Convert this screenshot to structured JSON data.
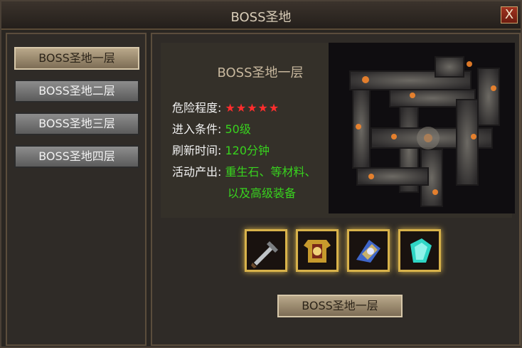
{
  "window": {
    "title": "BOSS圣地",
    "close_label": "X"
  },
  "sidebar": {
    "items": [
      {
        "label": "BOSS圣地一层",
        "active": true
      },
      {
        "label": "BOSS圣地二层",
        "active": false
      },
      {
        "label": "BOSS圣地三层",
        "active": false
      },
      {
        "label": "BOSS圣地四层",
        "active": false
      }
    ]
  },
  "details": {
    "title": "BOSS圣地一层",
    "danger_label": "危险程度:",
    "danger_stars": "★★★★★",
    "danger_rating": 5,
    "entry_label": "进入条件:",
    "entry_value": "50级",
    "refresh_label": "刷新时间:",
    "refresh_value": "120分钟",
    "output_label": "活动产出:",
    "output_value_line1": "重生石、等材料、",
    "output_value_line2": "以及高级装备"
  },
  "rewards": {
    "items": [
      {
        "icon": "sword-icon"
      },
      {
        "icon": "armor-icon"
      },
      {
        "icon": "crystal-icon"
      },
      {
        "icon": "gem-icon"
      }
    ]
  },
  "action_button": {
    "label": "BOSS圣地一层"
  },
  "colors": {
    "accent_gold": "#d8b24a",
    "value_green": "#38d31e",
    "star_red": "#ff2d2d"
  }
}
